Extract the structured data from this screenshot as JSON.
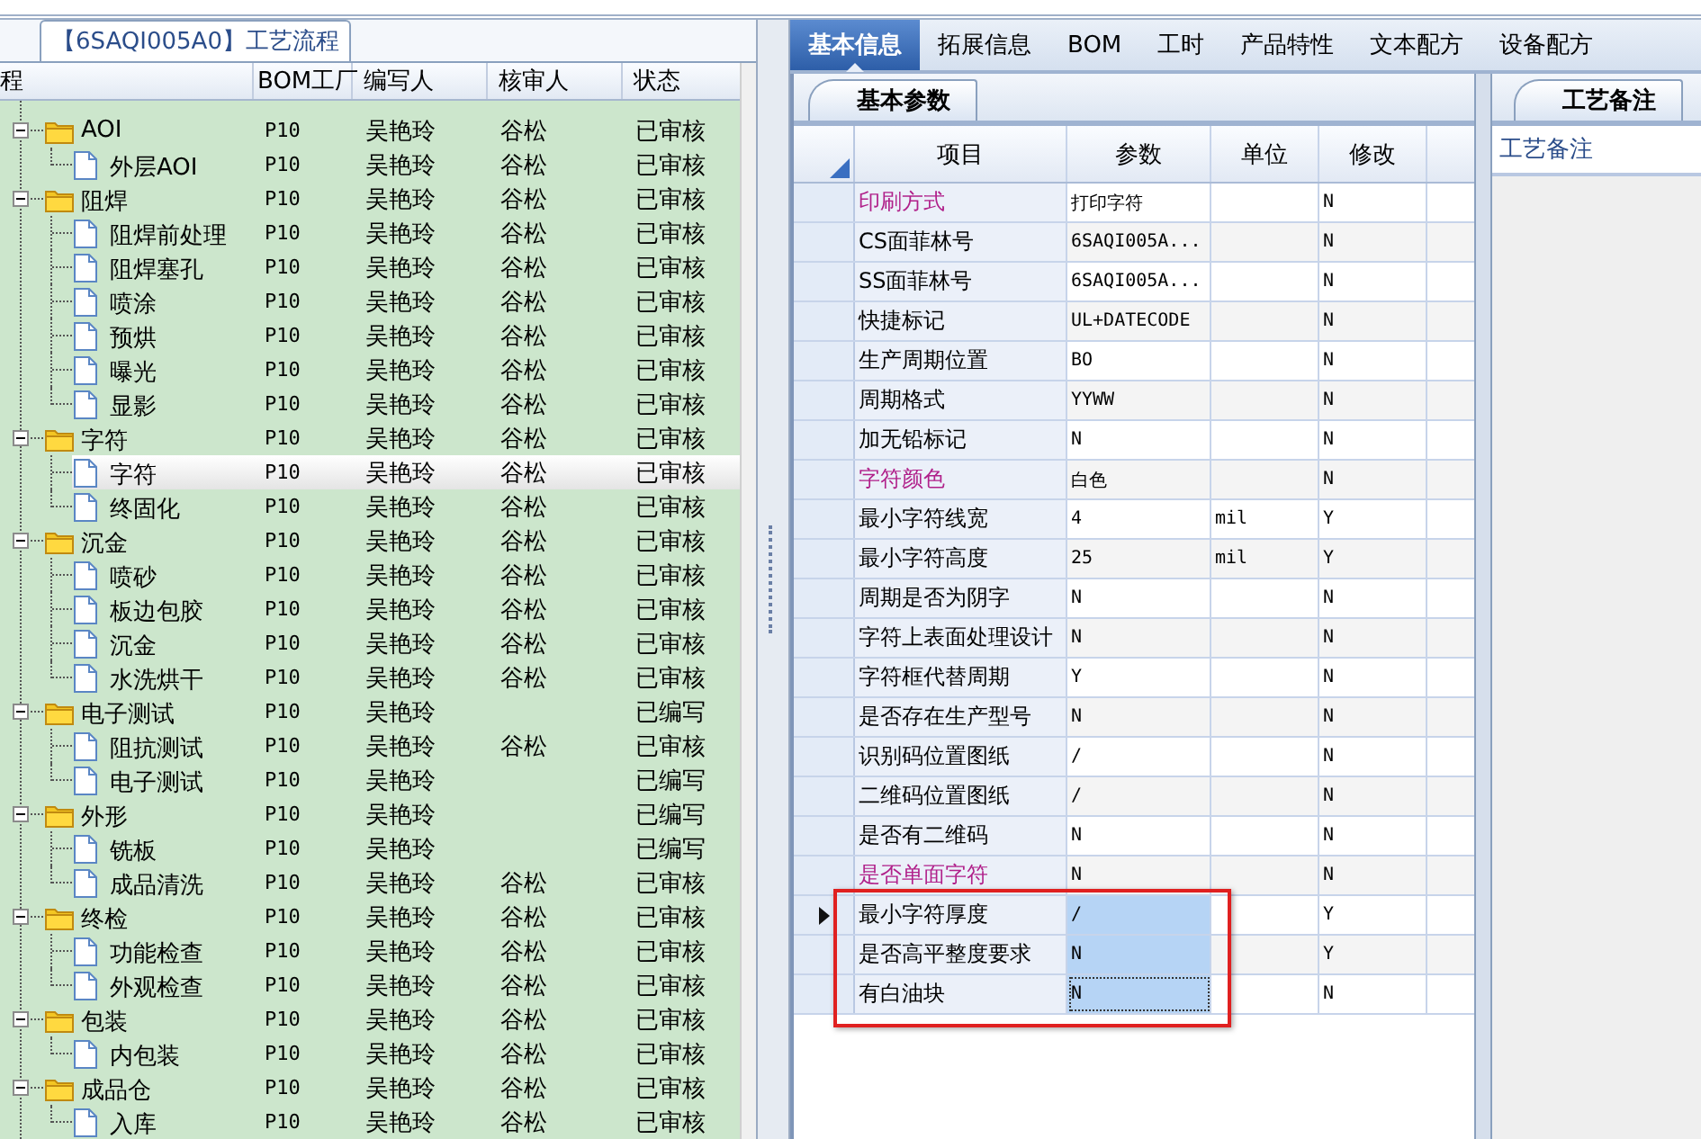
{
  "flow_panel": {
    "tab": "【6SAQI005A0】工艺流程",
    "columns": [
      "程",
      "BOM工厂",
      "编写人",
      "核审人",
      "状态"
    ],
    "nodes": [
      {
        "name": "AOI",
        "bom": "P10",
        "author": "吴艳玲",
        "reviewer": "谷松",
        "status": "已审核",
        "expanded": true,
        "children": [
          {
            "name": "外层AOI",
            "bom": "P10",
            "author": "吴艳玲",
            "reviewer": "谷松",
            "status": "已审核",
            "selected": false
          }
        ]
      },
      {
        "name": "阻焊",
        "bom": "P10",
        "author": "吴艳玲",
        "reviewer": "谷松",
        "status": "已审核",
        "expanded": true,
        "children": [
          {
            "name": "阻焊前处理",
            "bom": "P10",
            "author": "吴艳玲",
            "reviewer": "谷松",
            "status": "已审核",
            "selected": false
          },
          {
            "name": "阻焊塞孔",
            "bom": "P10",
            "author": "吴艳玲",
            "reviewer": "谷松",
            "status": "已审核",
            "selected": false
          },
          {
            "name": "喷涂",
            "bom": "P10",
            "author": "吴艳玲",
            "reviewer": "谷松",
            "status": "已审核",
            "selected": false
          },
          {
            "name": "预烘",
            "bom": "P10",
            "author": "吴艳玲",
            "reviewer": "谷松",
            "status": "已审核",
            "selected": false
          },
          {
            "name": "曝光",
            "bom": "P10",
            "author": "吴艳玲",
            "reviewer": "谷松",
            "status": "已审核",
            "selected": false
          },
          {
            "name": "显影",
            "bom": "P10",
            "author": "吴艳玲",
            "reviewer": "谷松",
            "status": "已审核",
            "selected": false
          }
        ]
      },
      {
        "name": "字符",
        "bom": "P10",
        "author": "吴艳玲",
        "reviewer": "谷松",
        "status": "已审核",
        "expanded": true,
        "children": [
          {
            "name": "字符",
            "bom": "P10",
            "author": "吴艳玲",
            "reviewer": "谷松",
            "status": "已审核",
            "selected": true
          },
          {
            "name": "终固化",
            "bom": "P10",
            "author": "吴艳玲",
            "reviewer": "谷松",
            "status": "已审核",
            "selected": false
          }
        ]
      },
      {
        "name": "沉金",
        "bom": "P10",
        "author": "吴艳玲",
        "reviewer": "谷松",
        "status": "已审核",
        "expanded": true,
        "children": [
          {
            "name": "喷砂",
            "bom": "P10",
            "author": "吴艳玲",
            "reviewer": "谷松",
            "status": "已审核",
            "selected": false
          },
          {
            "name": "板边包胶",
            "bom": "P10",
            "author": "吴艳玲",
            "reviewer": "谷松",
            "status": "已审核",
            "selected": false
          },
          {
            "name": "沉金",
            "bom": "P10",
            "author": "吴艳玲",
            "reviewer": "谷松",
            "status": "已审核",
            "selected": false
          },
          {
            "name": "水洗烘干",
            "bom": "P10",
            "author": "吴艳玲",
            "reviewer": "谷松",
            "status": "已审核",
            "selected": false
          }
        ]
      },
      {
        "name": "电子测试",
        "bom": "P10",
        "author": "吴艳玲",
        "status": "已编写",
        "expanded": true,
        "children": [
          {
            "name": "阻抗测试",
            "bom": "P10",
            "author": "吴艳玲",
            "reviewer": "谷松",
            "status": "已审核",
            "selected": false
          },
          {
            "name": "电子测试",
            "bom": "P10",
            "author": "吴艳玲",
            "status": "已编写",
            "selected": false
          }
        ]
      },
      {
        "name": "外形",
        "bom": "P10",
        "author": "吴艳玲",
        "status": "已编写",
        "expanded": true,
        "children": [
          {
            "name": "铣板",
            "bom": "P10",
            "author": "吴艳玲",
            "status": "已编写",
            "selected": false
          },
          {
            "name": "成品清洗",
            "bom": "P10",
            "author": "吴艳玲",
            "reviewer": "谷松",
            "status": "已审核",
            "selected": false
          }
        ]
      },
      {
        "name": "终检",
        "bom": "P10",
        "author": "吴艳玲",
        "reviewer": "谷松",
        "status": "已审核",
        "expanded": true,
        "children": [
          {
            "name": "功能检查",
            "bom": "P10",
            "author": "吴艳玲",
            "reviewer": "谷松",
            "status": "已审核",
            "selected": false
          },
          {
            "name": "外观检查",
            "bom": "P10",
            "author": "吴艳玲",
            "reviewer": "谷松",
            "status": "已审核",
            "selected": false
          }
        ]
      },
      {
        "name": "包装",
        "bom": "P10",
        "author": "吴艳玲",
        "reviewer": "谷松",
        "status": "已审核",
        "expanded": true,
        "children": [
          {
            "name": "内包装",
            "bom": "P10",
            "author": "吴艳玲",
            "reviewer": "谷松",
            "status": "已审核",
            "selected": false
          }
        ]
      },
      {
        "name": "成品仓",
        "bom": "P10",
        "author": "吴艳玲",
        "reviewer": "谷松",
        "status": "已审核",
        "expanded": true,
        "children": [
          {
            "name": "入库",
            "bom": "P10",
            "author": "吴艳玲",
            "reviewer": "谷松",
            "status": "已审核",
            "selected": false
          }
        ]
      }
    ]
  },
  "tabs": [
    {
      "label": "基本信息",
      "selected": true
    },
    {
      "label": "拓展信息",
      "selected": false
    },
    {
      "label": "BOM",
      "selected": false
    },
    {
      "label": "工时",
      "selected": false
    },
    {
      "label": "产品特性",
      "selected": false
    },
    {
      "label": "文本配方",
      "selected": false
    },
    {
      "label": "设备配方",
      "selected": false
    }
  ],
  "params": {
    "tab": "基本参数",
    "columns": [
      "项目",
      "参数",
      "单位",
      "修改"
    ],
    "rows": [
      {
        "item": "印刷方式",
        "value": "打印字符",
        "modified": "N",
        "flagged": true,
        "selected": false,
        "current": false,
        "focused": false
      },
      {
        "item": "CS面菲林号",
        "value": "6SAQI005A...",
        "modified": "N",
        "flagged": false,
        "selected": false,
        "current": false,
        "focused": false
      },
      {
        "item": "SS面菲林号",
        "value": "6SAQI005A...",
        "modified": "N",
        "flagged": false,
        "selected": false,
        "current": false,
        "focused": false
      },
      {
        "item": "快捷标记",
        "value": "UL+DATECODE",
        "modified": "N",
        "flagged": false,
        "selected": false,
        "current": false,
        "focused": false
      },
      {
        "item": "生产周期位置",
        "value": "BO",
        "modified": "N",
        "flagged": false,
        "selected": false,
        "current": false,
        "focused": false
      },
      {
        "item": "周期格式",
        "value": "YYWW",
        "modified": "N",
        "flagged": false,
        "selected": false,
        "current": false,
        "focused": false
      },
      {
        "item": "加无铅标记",
        "value": "N",
        "modified": "N",
        "flagged": false,
        "selected": false,
        "current": false,
        "focused": false
      },
      {
        "item": "字符颜色",
        "value": "白色",
        "modified": "N",
        "flagged": true,
        "selected": false,
        "current": false,
        "focused": false
      },
      {
        "item": "最小字符线宽",
        "value": "4",
        "unit": "mil",
        "modified": "Y",
        "flagged": false,
        "selected": false,
        "current": false,
        "focused": false
      },
      {
        "item": "最小字符高度",
        "value": "25",
        "unit": "mil",
        "modified": "Y",
        "flagged": false,
        "selected": false,
        "current": false,
        "focused": false
      },
      {
        "item": "周期是否为阴字",
        "value": "N",
        "modified": "N",
        "flagged": false,
        "selected": false,
        "current": false,
        "focused": false
      },
      {
        "item": "字符上表面处理设计",
        "value": "N",
        "modified": "N",
        "flagged": false,
        "selected": false,
        "current": false,
        "focused": false
      },
      {
        "item": "字符框代替周期",
        "value": "Y",
        "modified": "N",
        "flagged": false,
        "selected": false,
        "current": false,
        "focused": false
      },
      {
        "item": "是否存在生产型号",
        "value": "N",
        "modified": "N",
        "flagged": false,
        "selected": false,
        "current": false,
        "focused": false
      },
      {
        "item": "识别码位置图纸",
        "value": "/",
        "modified": "N",
        "flagged": false,
        "selected": false,
        "current": false,
        "focused": false
      },
      {
        "item": "二维码位置图纸",
        "value": "/",
        "modified": "N",
        "flagged": false,
        "selected": false,
        "current": false,
        "focused": false
      },
      {
        "item": "是否有二维码",
        "value": "N",
        "modified": "N",
        "flagged": false,
        "selected": false,
        "current": false,
        "focused": false
      },
      {
        "item": "是否单面字符",
        "value": "N",
        "modified": "N",
        "flagged": true,
        "selected": false,
        "current": false,
        "focused": false
      },
      {
        "item": "最小字符厚度",
        "value": "/",
        "modified": "Y",
        "flagged": false,
        "selected": true,
        "current": true,
        "focused": false
      },
      {
        "item": "是否高平整度要求",
        "value": "N",
        "modified": "Y",
        "flagged": false,
        "selected": true,
        "current": false,
        "focused": false
      },
      {
        "item": "有白油块",
        "value": "N",
        "modified": "N",
        "flagged": false,
        "selected": true,
        "current": false,
        "focused": true
      }
    ]
  },
  "notes": {
    "tab": "工艺备注",
    "label": "工艺备注"
  }
}
